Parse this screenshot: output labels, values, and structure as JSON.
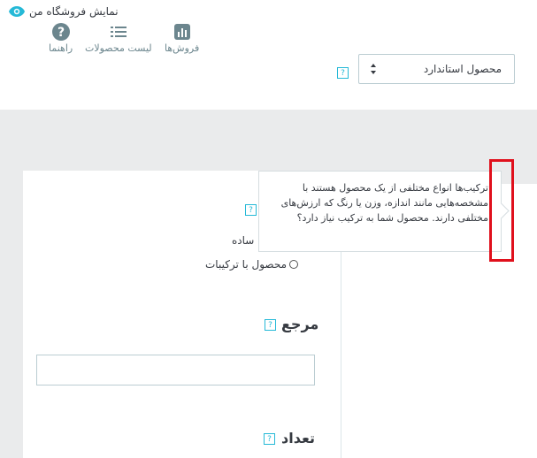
{
  "header": {
    "view_store_label": "نمایش فروشگاه من",
    "view_store_icon": "eye-icon"
  },
  "toolbar": {
    "product_type_value": "محصول استاندارد",
    "help_mark": "?",
    "sales_label": "فروش‌ها",
    "sales_icon": "bar-chart-icon",
    "product_list_label": "لیست محصولات",
    "product_list_icon": "list-icon",
    "help_label": "راهنما",
    "help_icon": "question-circle-icon"
  },
  "form": {
    "help_mark": "?",
    "simple_product_partial": "ساده",
    "combinations_label": "محصول با ترکیبات",
    "reference_label": "مرجع",
    "reference_value": "",
    "quantity_label": "تعداد"
  },
  "tooltip": {
    "text": "ترکیب‌ها انواع مختلفی از یک محصول هستند با مشخصه‌هایی مانند اندازه، وزن یا رنگ که ارزش‌های مختلفی دارند. محصول شما به ترکیب نیاز دارد؟"
  },
  "colors": {
    "accent": "#25b9d7",
    "highlight": "#e0101c",
    "background": "#eaebec"
  }
}
